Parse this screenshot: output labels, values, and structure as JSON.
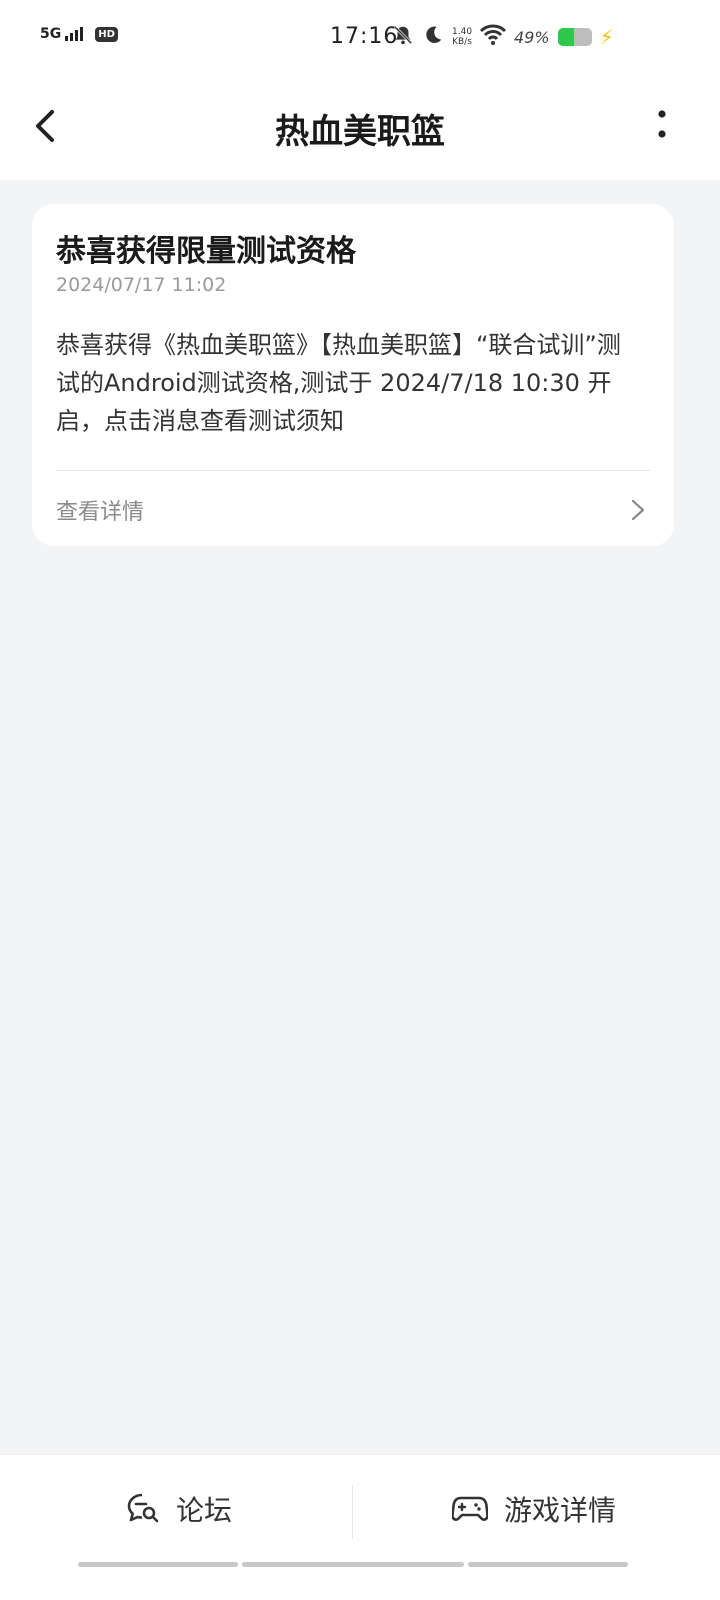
{
  "status_bar": {
    "network": "5G",
    "hd": "HD",
    "time": "17:16",
    "speed_value": "1.40",
    "speed_unit": "KB/s",
    "battery_percent": "49%",
    "battery_level": 0.49,
    "battery_color": "#2ec84a",
    "icons": [
      "signal-icon",
      "bell-muted-icon",
      "moon-icon",
      "wifi-icon",
      "battery-icon",
      "charging-bolt-icon"
    ]
  },
  "header": {
    "title": "热血美职篮",
    "back_icon": "chevron-left-icon",
    "more_icon": "more-vertical-icon"
  },
  "message": {
    "title": "恭喜获得限量测试资格",
    "timestamp": "2024/07/17 11:02",
    "body": "恭喜获得《热血美职篮》【热血美职篮】“联合试训”测试的Android测试资格,测试于 2024/7/18 10:30 开启，点击消息查看测试须知",
    "link_label": "查看详情",
    "link_icon": "chevron-right-icon"
  },
  "bottom_nav": {
    "forum_label": "论坛",
    "forum_icon": "chat-search-icon",
    "game_label": "游戏详情",
    "game_icon": "gamepad-icon"
  },
  "colors": {
    "background": "#f3f4f6",
    "surface": "#ffffff",
    "text_primary": "#1b1b1b",
    "text_secondary": "#9a9a9a"
  }
}
